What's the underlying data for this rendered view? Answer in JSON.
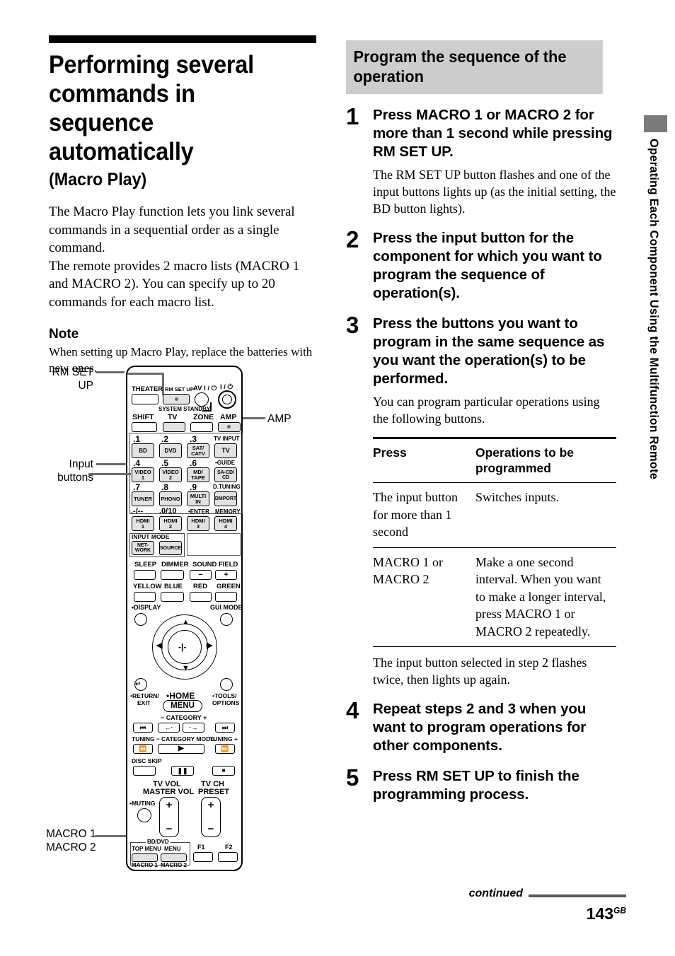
{
  "left": {
    "title": "Performing several commands in sequence automatically",
    "subtitle": "(Macro Play)",
    "intro_p1": "The Macro Play function lets you link several commands in a sequential order as a single command.",
    "intro_p2": "The remote provides 2 macro lists (MACRO 1 and MACRO 2). You can specify up to 20 commands for each macro list.",
    "note_heading": "Note",
    "note_body": "When setting up Macro Play, replace the batteries with new ones."
  },
  "right": {
    "section_title": "Program the sequence of the operation",
    "steps": [
      {
        "num": "1",
        "head": "Press MACRO 1 or MACRO 2 for more than 1 second while pressing RM SET UP.",
        "sub": "The RM SET UP button flashes and one of the input buttons lights up (as the initial setting, the BD button lights)."
      },
      {
        "num": "2",
        "head": "Press the input button for the component for which you want to program the sequence of operation(s).",
        "sub": ""
      },
      {
        "num": "3",
        "head": "Press the buttons you want to program in the same sequence as you want the operation(s) to be performed.",
        "sub": "You can program particular operations using the following buttons."
      },
      {
        "num": "4",
        "head": "Repeat steps 2 and 3 when you want to program operations for other components.",
        "sub": ""
      },
      {
        "num": "5",
        "head": "Press RM SET UP to finish the programming process.",
        "sub": ""
      }
    ],
    "table": {
      "headers": [
        "Press",
        "Operations to be programmed"
      ],
      "rows": [
        [
          "The input button for more than 1 second",
          "Switches inputs."
        ],
        [
          "MACRO 1 or MACRO 2",
          "Make a one second interval. When you want to make a longer interval, press MACRO 1 or MACRO 2 repeatedly."
        ]
      ]
    },
    "after_table": "The input button selected in step 2 flashes twice, then lights up again."
  },
  "side_tab": {
    "text": "Operating Each Component Using the Multifunction Remote",
    "color": "#7a7a7a"
  },
  "footer": {
    "continued": "continued",
    "page": "143",
    "page_sup": "GB"
  },
  "figure": {
    "callouts": {
      "rm_set_up": "RM SET\nUP",
      "rm_set_up_l1": "RM SET",
      "rm_set_up_l2": "UP",
      "input_buttons_l1": "Input",
      "input_buttons_l2": "buttons",
      "amp": "AMP",
      "macro1": "MACRO 1",
      "macro2": "MACRO 2"
    },
    "remote": {
      "row_theater": [
        "THEATER",
        "RM SET UP"
      ],
      "av_power": "AV I / ⏻",
      "main_power": "I / ⏻",
      "system_standby": "SYSTEM STANDBY",
      "row_mode": [
        "SHIFT",
        "TV",
        "ZONE",
        "AMP"
      ],
      "num_labels": [
        ".1",
        ".2",
        ".3",
        ".4",
        ".5",
        ".6",
        ".7",
        ".8",
        ".9",
        ".-/--",
        ".0/10",
        "•ENTER"
      ],
      "input_grid": [
        [
          "BD",
          "DVD",
          "SAT/\nCATV",
          "TV"
        ],
        [
          "VIDEO\n1",
          "VIDEO\n2",
          "MD/\nTAPE",
          "SA-CD/\nCD"
        ],
        [
          "TUNER",
          "PHONO",
          "MULTI\nIN",
          "DMPORT"
        ],
        [
          "HDMI\n1",
          "HDMI\n2",
          "HDMI\n3",
          "HDMI\n4"
        ]
      ],
      "col4_labels": [
        "TV INPUT",
        "•GUIDE",
        "D.TUNING",
        "MEMORY"
      ],
      "input_mode": "INPUT MODE",
      "network": "NET-\nWORK",
      "source": "SOURCE",
      "row_sleep": [
        "SLEEP",
        "DIMMER"
      ],
      "sound_field": "SOUND FIELD",
      "sound_minus": "−",
      "sound_plus": "+",
      "color_buttons": [
        "YELLOW",
        "BLUE",
        "RED",
        "GREEN"
      ],
      "display": "•DISPLAY",
      "gui_mode": "GUI MODE",
      "home": "•HOME",
      "menu": "MENU",
      "return_exit_l1": "•RETURN/",
      "return_exit_l2": "EXIT",
      "tools_l1": "•TOOLS/",
      "tools_l2": "OPTIONS",
      "category": "− CATEGORY +",
      "tuning_minus": "TUNING −",
      "tuning_plus": "TUNING +",
      "category_mode": "CATEGORY MODE",
      "disc_skip": "DISC SKIP",
      "tv_vol_l1": "TV VOL",
      "tv_vol_l2": "MASTER VOL",
      "tv_ch_l1": "TV CH",
      "tv_ch_l2": "PRESET",
      "muting": "•MUTING",
      "vol_plus": "+",
      "vol_minus": "−",
      "bd_dvd": "BD/DVD",
      "top_menu": "TOP MENU",
      "menu_btn": "MENU",
      "macro1": "MACRO 1",
      "macro2": "MACRO 2",
      "f1": "F1",
      "f2": "F2"
    }
  }
}
